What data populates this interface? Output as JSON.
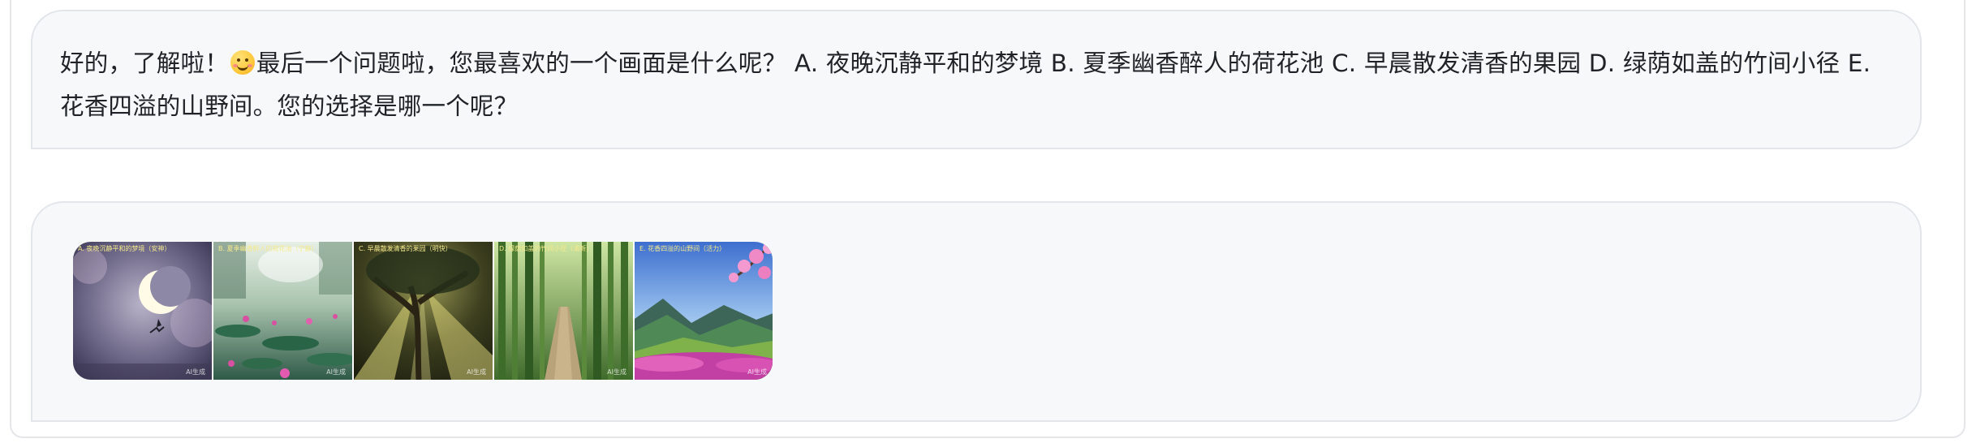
{
  "message": {
    "text_before_emoji": "好的，了解啦！",
    "emoji": "smiling-face",
    "text_after_emoji": "最后一个问题啦，您最喜欢的一个画面是什么呢？ A. 夜晚沉静平和的梦境 B. 夏季幽香醉人的荷花池 C. 早晨散发清香的果园 D. 绿荫如盖的竹间小径 E. 花香四溢的山野间。您的选择是哪一个呢？"
  },
  "images": [
    {
      "caption": "A. 夜晚沉静平和的梦境（安神）",
      "watermark": "AI生成",
      "scene": "moonlit-night"
    },
    {
      "caption": "B. 夏季幽香醉人的荷花池（宁静）",
      "watermark": "AI生成",
      "scene": "lotus-pond"
    },
    {
      "caption": "C. 早晨散发清香的果园（明快）",
      "watermark": "AI生成",
      "scene": "morning-orchard"
    },
    {
      "caption": "D. 绿荫如盖的竹间小径（清新）",
      "watermark": "AI生成",
      "scene": "bamboo-path"
    },
    {
      "caption": "E. 花香四溢的山野间（活力）",
      "watermark": "AI生成",
      "scene": "flowery-mountains"
    }
  ]
}
